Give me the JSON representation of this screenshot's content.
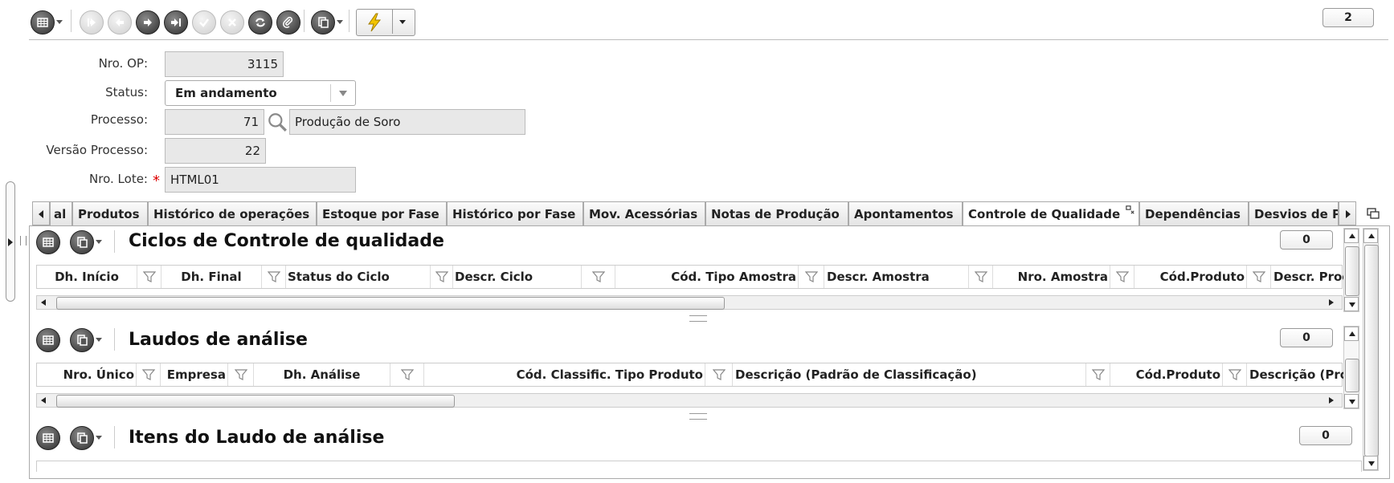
{
  "toolbar": {
    "counter": "2",
    "icons": [
      "grid-menu-icon",
      "first-record-icon",
      "previous-record-icon",
      "next-record-icon",
      "last-record-icon",
      "confirm-icon",
      "cancel-icon",
      "refresh-icon",
      "attach-icon",
      "copy-menu-icon",
      "action-bolt-icon"
    ]
  },
  "form": {
    "nro_op": {
      "label": "Nro. OP:",
      "value": "3115"
    },
    "status": {
      "label": "Status:",
      "value": "Em andamento"
    },
    "processo": {
      "label": "Processo:",
      "code": "71",
      "desc": "Produção de Soro"
    },
    "versao": {
      "label": "Versão Processo:",
      "value": "22"
    },
    "lote": {
      "label": "Nro. Lote:",
      "required": "*",
      "value": "HTML01"
    }
  },
  "tabs": [
    {
      "label": "al"
    },
    {
      "label": "Produtos"
    },
    {
      "label": "Histórico de operações"
    },
    {
      "label": "Estoque por Fase"
    },
    {
      "label": "Histórico por Fase"
    },
    {
      "label": "Mov. Acessórias"
    },
    {
      "label": "Notas de Produção"
    },
    {
      "label": "Apontamentos"
    },
    {
      "label": "Controle de Qualidade"
    },
    {
      "label": "Dependências"
    },
    {
      "label": "Desvios de P"
    }
  ],
  "sections": {
    "ciclos": {
      "title": "Ciclos de Controle de qualidade",
      "count": "0",
      "columns": [
        "Dh. Início",
        "Dh. Final",
        "Status do Ciclo",
        "Descr. Ciclo",
        "Cód. Tipo Amostra",
        "Descr. Amostra",
        "Nro. Amostra",
        "Cód.Produto",
        "Descr. Produto"
      ]
    },
    "laudos": {
      "title": "Laudos de análise",
      "count": "0",
      "columns": [
        "Nro. Único",
        "Empresa",
        "Dh. Análise",
        "Cód. Classific. Tipo Produto",
        "Descrição (Padrão de Classificação)",
        "Cód.Produto",
        "Descrição (Produto"
      ]
    },
    "itens": {
      "title": "Itens do Laudo de análise",
      "count": "0"
    }
  }
}
